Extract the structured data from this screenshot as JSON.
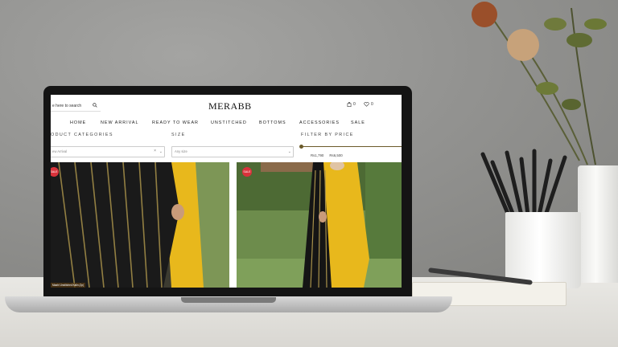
{
  "header": {
    "search_placeholder": "e here to search",
    "logo": "MERABB",
    "cart_count": "0",
    "wishlist_count": "0"
  },
  "nav": {
    "items": [
      "HOME",
      "NEW ARRIVAL",
      "READY TO WEAR",
      "UNSTITCHED",
      "BOTTOMS",
      "ACCESSORIES",
      "SALE"
    ]
  },
  "filters": {
    "categories_label": "ODUCT CATEGORIES",
    "categories_value": "ew Arrival",
    "size_label": "SIZE",
    "size_value": "Any size",
    "price_label": "FILTER BY PRICE",
    "price_min": "Rs1,790",
    "price_max": "Rs6,500"
  },
  "products": [
    {
      "badge": "SALE",
      "caption": "Maahi Unstitched Kalin (2p)"
    },
    {
      "badge": "SALE"
    }
  ],
  "colors": {
    "accent_gold": "#6b5a2a",
    "sale_red": "#d9323b",
    "dress_yellow": "#e8b81c"
  }
}
